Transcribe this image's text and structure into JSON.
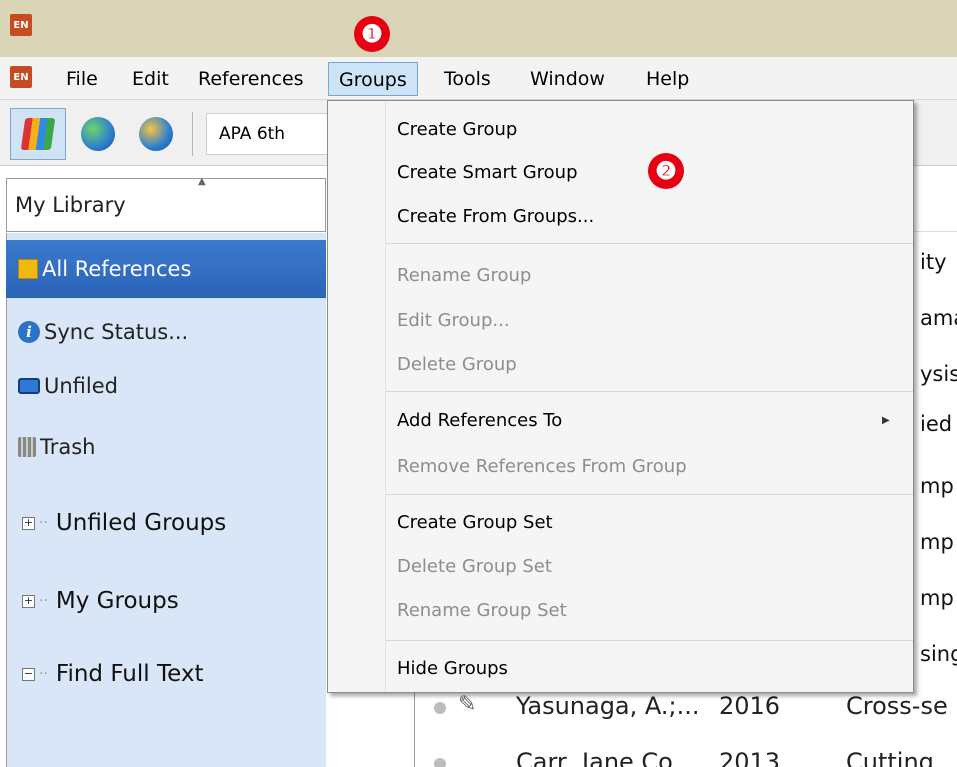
{
  "app": {
    "icon_text": "EN"
  },
  "menubar": {
    "items": [
      {
        "label": "File"
      },
      {
        "label": "Edit"
      },
      {
        "label": "References"
      },
      {
        "label": "Groups"
      },
      {
        "label": "Tools"
      },
      {
        "label": "Window"
      },
      {
        "label": "Help"
      }
    ]
  },
  "toolbar": {
    "style_value": "APA 6th"
  },
  "library": {
    "selector_label": "My Library",
    "groups": [
      {
        "label": "All References",
        "icon": "book-icon"
      },
      {
        "label": "Sync Status...",
        "icon": "info-icon"
      },
      {
        "label": "Unfiled",
        "icon": "folder-icon"
      },
      {
        "label": "Trash",
        "icon": "trash-icon"
      }
    ],
    "group_sets": [
      {
        "label": "Unfiled Groups",
        "expander": "+"
      },
      {
        "label": "My Groups",
        "expander": "+"
      },
      {
        "label": "Find Full Text",
        "expander": "−"
      }
    ]
  },
  "groups_menu": {
    "section1": [
      "Create Group",
      "Create Smart Group",
      "Create From Groups..."
    ],
    "section2": [
      "Rename Group",
      "Edit Group...",
      "Delete Group"
    ],
    "section3": [
      "Add References To",
      "Remove References From Group"
    ],
    "section4": [
      "Create Group Set",
      "Delete Group Set",
      "Rename Group Set"
    ],
    "section5": [
      "Hide Groups"
    ]
  },
  "reference_list": {
    "peek_text": [
      "ity",
      "ama",
      "ysis",
      "ied",
      "mp",
      "mp",
      "mp",
      "sing"
    ],
    "rows": [
      {
        "author": "Yasunaga, A.;...",
        "year": "2016",
        "title": "Cross-se"
      },
      {
        "author": "Carr, Jane Co...",
        "year": "2013",
        "title": "Cutting"
      }
    ]
  },
  "annotations": {
    "step1": "❶",
    "step2": "❷"
  },
  "colors": {
    "menu_highlight": "#cde4f7",
    "selected_group": "#2b64b8",
    "badge": "#e60012"
  }
}
